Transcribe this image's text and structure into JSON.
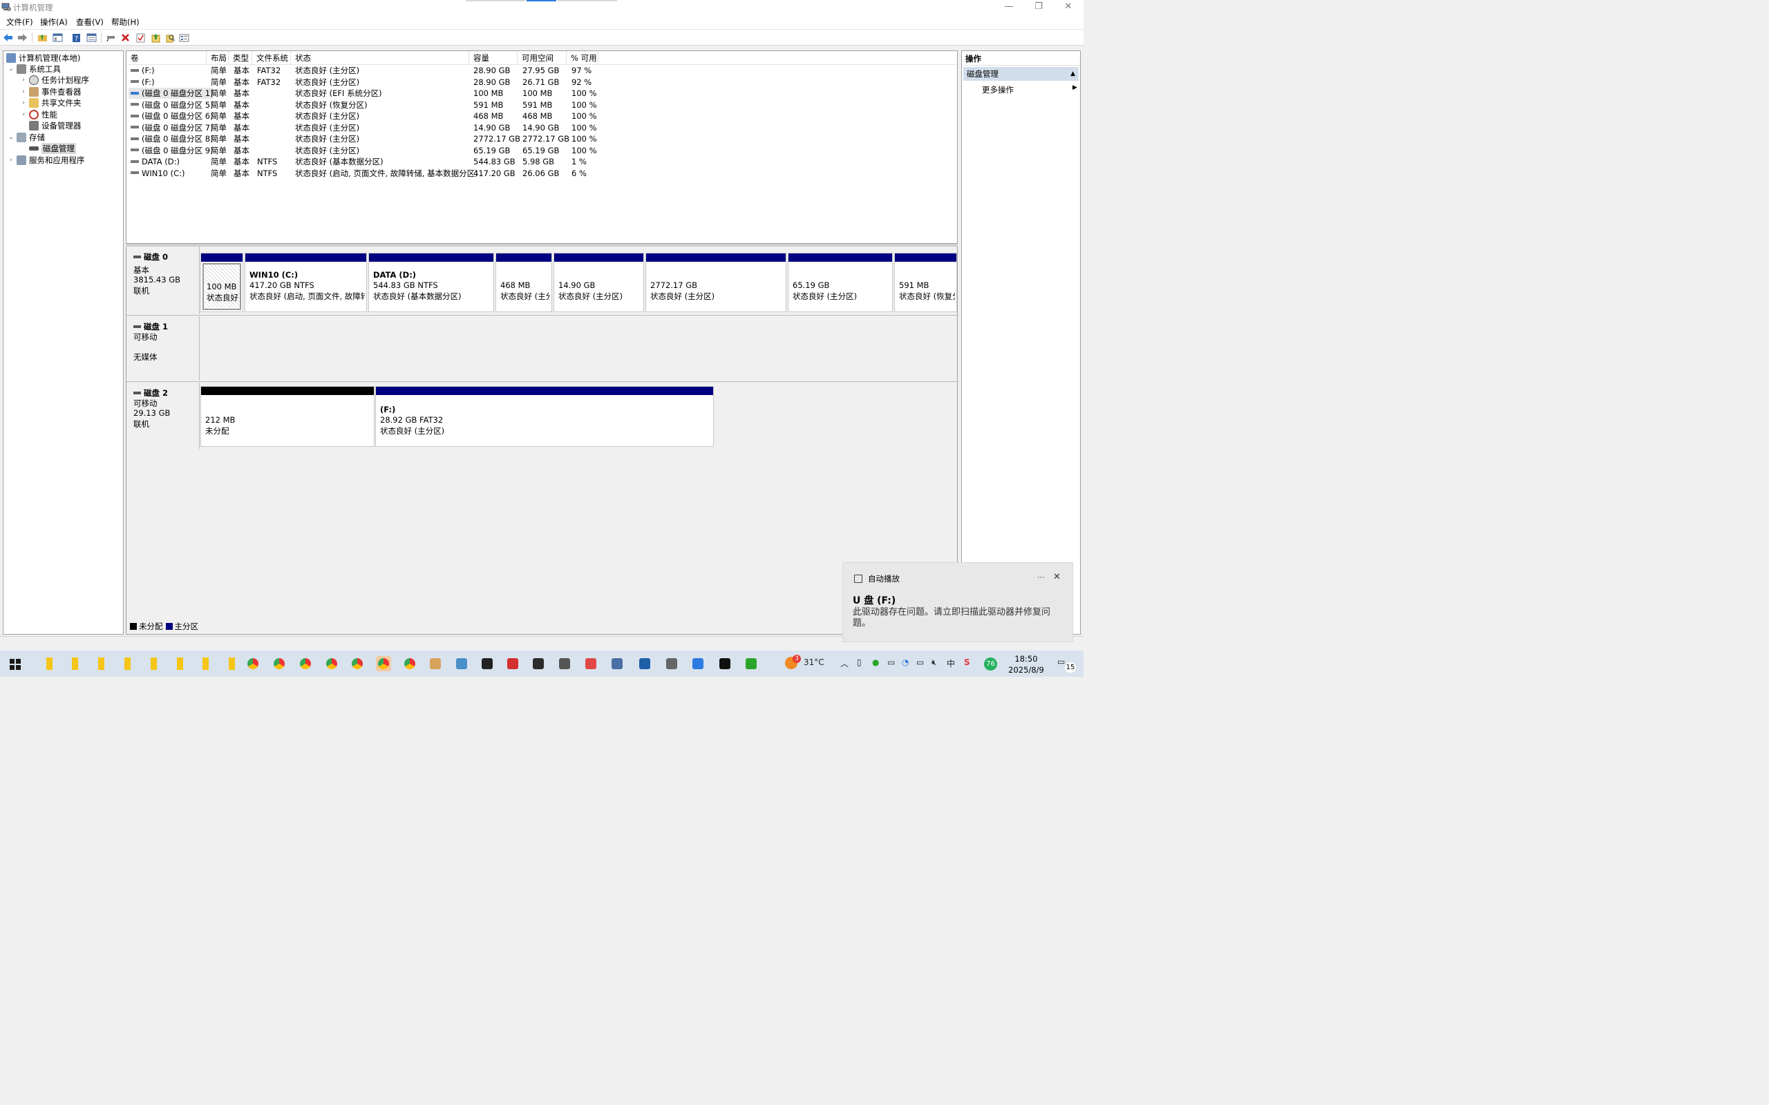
{
  "window": {
    "title": "计算机管理",
    "minimize_glyph": "—",
    "restore_glyph": "❐",
    "close_glyph": "✕"
  },
  "menu": [
    "文件(F)",
    "操作(A)",
    "查看(V)",
    "帮助(H)"
  ],
  "toolbar": [
    "back-icon",
    "forward-icon",
    "up-folder-icon",
    "show-hide-tree-icon",
    "help-icon",
    "properties-icon",
    "connect-icon",
    "delete-icon",
    "check-icon",
    "export-icon",
    "search-icon",
    "view-icon"
  ],
  "tree": {
    "root": "计算机管理(本地)",
    "system_tools": "系统工具",
    "task_scheduler": "任务计划程序",
    "event_viewer": "事件查看器",
    "shared_folders": "共享文件夹",
    "performance": "性能",
    "device_manager": "设备管理器",
    "storage": "存储",
    "disk_management": "磁盘管理",
    "services_apps": "服务和应用程序"
  },
  "volume_list": {
    "headers": [
      "卷",
      "布局",
      "类型",
      "文件系统",
      "状态",
      "容量",
      "可用空间",
      "% 可用"
    ],
    "rows": [
      {
        "name": "(F:)",
        "layout": "简单",
        "type": "基本",
        "fs": "FAT32",
        "status": "状态良好 (主分区)",
        "capacity": "28.90 GB",
        "free": "27.95 GB",
        "pct": "97 %"
      },
      {
        "name": "(F:)",
        "layout": "简单",
        "type": "基本",
        "fs": "FAT32",
        "status": "状态良好 (主分区)",
        "capacity": "28.90 GB",
        "free": "26.71 GB",
        "pct": "92 %"
      },
      {
        "name": "(磁盘 0 磁盘分区 1)",
        "layout": "简单",
        "type": "基本",
        "fs": "",
        "status": "状态良好 (EFI 系统分区)",
        "capacity": "100 MB",
        "free": "100 MB",
        "pct": "100 %"
      },
      {
        "name": "(磁盘 0 磁盘分区 5)",
        "layout": "简单",
        "type": "基本",
        "fs": "",
        "status": "状态良好 (恢复分区)",
        "capacity": "591 MB",
        "free": "591 MB",
        "pct": "100 %"
      },
      {
        "name": "(磁盘 0 磁盘分区 6)",
        "layout": "简单",
        "type": "基本",
        "fs": "",
        "status": "状态良好 (主分区)",
        "capacity": "468 MB",
        "free": "468 MB",
        "pct": "100 %"
      },
      {
        "name": "(磁盘 0 磁盘分区 7)",
        "layout": "简单",
        "type": "基本",
        "fs": "",
        "status": "状态良好 (主分区)",
        "capacity": "14.90 GB",
        "free": "14.90 GB",
        "pct": "100 %"
      },
      {
        "name": "(磁盘 0 磁盘分区 8)",
        "layout": "简单",
        "type": "基本",
        "fs": "",
        "status": "状态良好 (主分区)",
        "capacity": "2772.17 GB",
        "free": "2772.17 GB",
        "pct": "100 %"
      },
      {
        "name": "(磁盘 0 磁盘分区 9)",
        "layout": "简单",
        "type": "基本",
        "fs": "",
        "status": "状态良好 (主分区)",
        "capacity": "65.19 GB",
        "free": "65.19 GB",
        "pct": "100 %"
      },
      {
        "name": "DATA (D:)",
        "layout": "简单",
        "type": "基本",
        "fs": "NTFS",
        "status": "状态良好 (基本数据分区)",
        "capacity": "544.83 GB",
        "free": "5.98 GB",
        "pct": "1 %"
      },
      {
        "name": "WIN10 (C:)",
        "layout": "简单",
        "type": "基本",
        "fs": "NTFS",
        "status": "状态良好 (启动, 页面文件, 故障转储, 基本数据分区)",
        "capacity": "417.20 GB",
        "free": "26.06 GB",
        "pct": "6 %"
      }
    ]
  },
  "disks": {
    "disk0": {
      "name": "磁盘 0",
      "kind": "基本",
      "size": "3815.43 GB",
      "state": "联机",
      "partitions": [
        {
          "title": "",
          "line1": "100 MB",
          "line2": "状态良好 (EFI 系统分区)"
        },
        {
          "title": "WIN10  (C:)",
          "line1": "417.20 GB NTFS",
          "line2": "状态良好 (启动, 页面文件, 故障转储, 基本数据分区)"
        },
        {
          "title": "DATA  (D:)",
          "line1": "544.83 GB NTFS",
          "line2": "状态良好 (基本数据分区)"
        },
        {
          "title": "",
          "line1": "468 MB",
          "line2": "状态良好 (主分区)"
        },
        {
          "title": "",
          "line1": "14.90 GB",
          "line2": "状态良好 (主分区)"
        },
        {
          "title": "",
          "line1": "2772.17 GB",
          "line2": "状态良好 (主分区)"
        },
        {
          "title": "",
          "line1": "65.19 GB",
          "line2": "状态良好 (主分区)"
        },
        {
          "title": "",
          "line1": "591 MB",
          "line2": "状态良好 (恢复分区)"
        }
      ]
    },
    "disk1": {
      "name": "磁盘 1",
      "kind": "可移动",
      "state": "无媒体"
    },
    "disk2": {
      "name": "磁盘 2",
      "kind": "可移动",
      "size": "29.13 GB",
      "state": "联机",
      "partitions": [
        {
          "title": "",
          "line1": "212 MB",
          "line2": "未分配"
        },
        {
          "title": "(F:)",
          "line1": "28.92 GB FAT32",
          "line2": "状态良好 (主分区)"
        }
      ]
    }
  },
  "legend": {
    "unallocated": "未分配",
    "primary": "主分区",
    "colors": {
      "unallocated": "#000000",
      "primary": "#000080"
    }
  },
  "actions": {
    "header": "操作",
    "selected": "磁盘管理",
    "more": "更多操作"
  },
  "toast": {
    "app": "自动播放",
    "more": "···",
    "close": "✕",
    "title": "U 盘 (F:)",
    "body": "此驱动器存在问题。请立即扫描此驱动器并修复问题。"
  },
  "taskbar": {
    "weather_badge": "3",
    "temperature": "31°C",
    "time": "18:50",
    "date": "2025/8/9",
    "notification_count": "15",
    "green_badge": "76",
    "ime": "中"
  }
}
